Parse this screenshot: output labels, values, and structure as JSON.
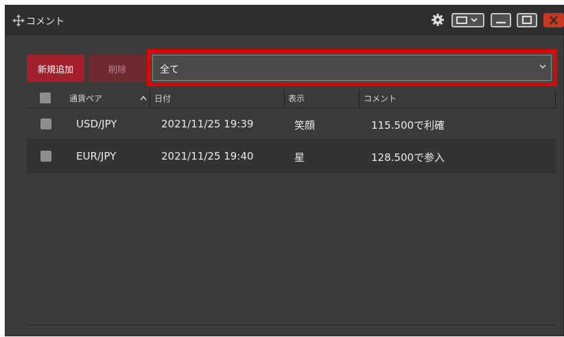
{
  "window": {
    "title": "コメント",
    "icons": [
      "move-icon",
      "gear-icon",
      "layout-icon",
      "minimize-icon",
      "maximize-icon",
      "close-icon"
    ],
    "close_color": "#c8371f"
  },
  "toolbar": {
    "new_label": "新規追加",
    "delete_label": "削除",
    "accent_color": "#a1202c"
  },
  "filter": {
    "value": "全て",
    "highlight_color": "#e60000"
  },
  "table": {
    "headers": [
      "通貨ペア",
      "日付",
      "表示",
      "コメント"
    ],
    "rows": [
      {
        "pair": "USD/JPY",
        "date": "2021/11/25 19:39",
        "display": "笑顔",
        "comment": "115.500で利確"
      },
      {
        "pair": "EUR/JPY",
        "date": "2021/11/25 19:40",
        "display": "星",
        "comment": "128.500で参入"
      }
    ]
  }
}
